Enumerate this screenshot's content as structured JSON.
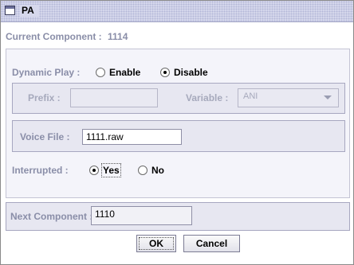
{
  "window": {
    "title": "PA",
    "icon": "window-icon"
  },
  "current_component": {
    "label": "Current Component :",
    "value": "1114"
  },
  "dynamic_play": {
    "label": "Dynamic Play :",
    "options": [
      {
        "label": "Enable",
        "selected": false
      },
      {
        "label": "Disable",
        "selected": true
      }
    ]
  },
  "prefix": {
    "label": "Prefix :",
    "value": ""
  },
  "variable": {
    "label": "Variable :",
    "value": "ANI"
  },
  "voice_file": {
    "label": "Voice File :",
    "value": "1111.raw"
  },
  "interrupted": {
    "label": "Interrupted :",
    "options": [
      {
        "label": "Yes",
        "selected": true
      },
      {
        "label": "No",
        "selected": false
      }
    ]
  },
  "next_component": {
    "label": "Next Component :",
    "value": "1110"
  },
  "buttons": {
    "ok": "OK",
    "cancel": "Cancel"
  }
}
